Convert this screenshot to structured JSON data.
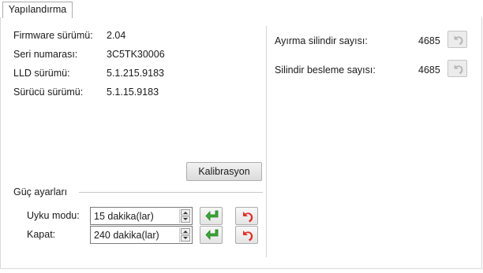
{
  "tab": {
    "label": "Yapılandırma"
  },
  "info": [
    {
      "label": "Firmware sürümü:",
      "value": "2.04"
    },
    {
      "label": "Seri numarası:",
      "value": "3C5TK30006"
    },
    {
      "label": "LLD sürümü:",
      "value": "5.1.215.9183"
    },
    {
      "label": "Sürücü sürümü:",
      "value": "5.1.15.9183"
    }
  ],
  "calibrate_label": "Kalibrasyon",
  "power": {
    "group_label": "Güç ayarları",
    "sleep": {
      "label": "Uyku modu:",
      "value": "15 dakika(lar)"
    },
    "off": {
      "label": "Kapat:",
      "value": "240 dakika(lar)"
    }
  },
  "counters": [
    {
      "label": "Ayırma silindir sayısı:",
      "value": "4685"
    },
    {
      "label": "Silindir besleme sayısı:",
      "value": "4685"
    }
  ],
  "icons": {
    "apply": "apply-green-arrow-icon",
    "reset": "reset-red-undo-icon",
    "counter_reset": "reset-gray-undo-icon"
  },
  "colors": {
    "apply_green": "#3aa935",
    "reset_red": "#e0302a",
    "disabled_gray": "#b5b5b5"
  }
}
